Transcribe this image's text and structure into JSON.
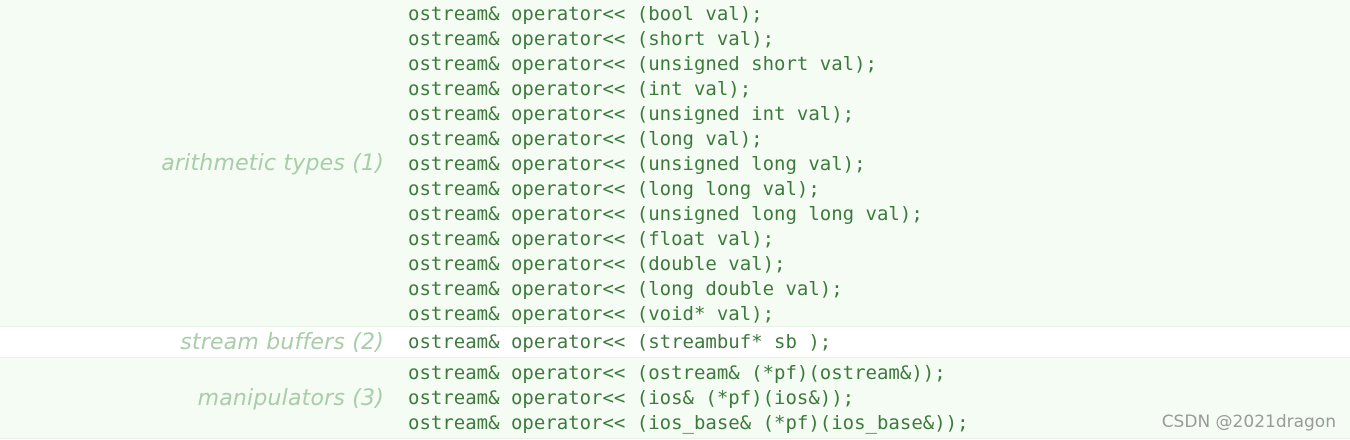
{
  "sections": [
    {
      "label": "arithmetic types (1)",
      "lines": [
        "ostream& operator<< (bool val);",
        "ostream& operator<< (short val);",
        "ostream& operator<< (unsigned short val);",
        "ostream& operator<< (int val);",
        "ostream& operator<< (unsigned int val);",
        "ostream& operator<< (long val);",
        "ostream& operator<< (unsigned long val);",
        "ostream& operator<< (long long val);",
        "ostream& operator<< (unsigned long long val);",
        "ostream& operator<< (float val);",
        "ostream& operator<< (double val);",
        "ostream& operator<< (long double val);",
        "ostream& operator<< (void* val);"
      ]
    },
    {
      "label": "stream buffers (2)",
      "lines": [
        "ostream& operator<< (streambuf* sb );"
      ]
    },
    {
      "label": "manipulators (3)",
      "lines": [
        "ostream& operator<< (ostream& (*pf)(ostream&));",
        "ostream& operator<< (ios& (*pf)(ios&));",
        "ostream& operator<< (ios_base& (*pf)(ios_base&));"
      ]
    }
  ],
  "watermark": "CSDN @2021dragon",
  "colors": {
    "code_text": "#3c7a3c",
    "label_text": "#a9cca9",
    "section_bg": "#f4fcf4",
    "alt_bg": "#ffffff"
  }
}
